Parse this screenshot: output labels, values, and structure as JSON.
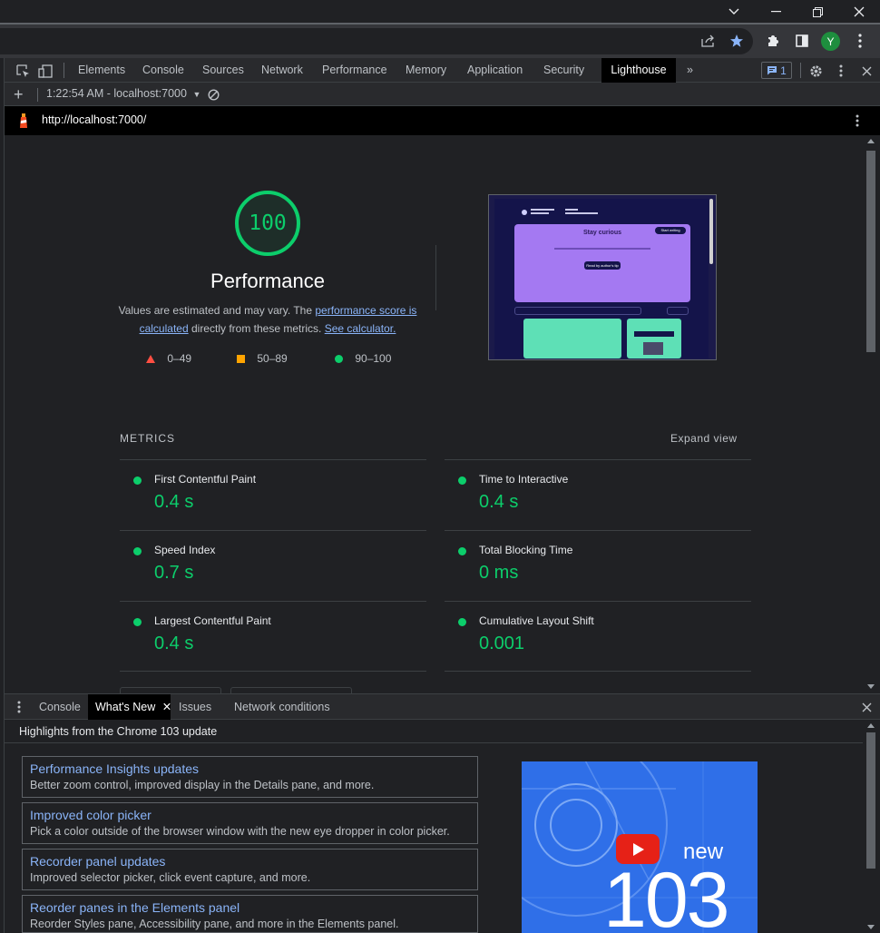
{
  "window": {
    "minimize": "—",
    "restore": "❐",
    "close": "✕",
    "dropdown": "⌄"
  },
  "toolbar": {
    "avatar_letter": "Y"
  },
  "devtools": {
    "tabs": [
      {
        "label": "Elements"
      },
      {
        "label": "Console"
      },
      {
        "label": "Sources"
      },
      {
        "label": "Network"
      },
      {
        "label": "Performance"
      },
      {
        "label": "Memory"
      },
      {
        "label": "Application"
      },
      {
        "label": "Security"
      },
      {
        "label": "Lighthouse"
      }
    ],
    "more_tabs": "»",
    "issues_count": "1",
    "lighthouse_toolbar": {
      "plus": "+",
      "report_select": "1:22:54 AM - localhost:7000",
      "caret": "▼"
    },
    "url": "http://localhost:7000/"
  },
  "report": {
    "score": "100",
    "category_title": "Performance",
    "desc_prefix": "Values are estimated and may vary. The ",
    "desc_link1": "performance score is calculated",
    "desc_middle": " directly from these metrics. ",
    "desc_link2": "See calculator.",
    "legend": [
      {
        "range": "0–49",
        "color": "#ff4e42"
      },
      {
        "range": "50–89",
        "color": "#ffa400"
      },
      {
        "range": "90–100",
        "color": "#0cce6b"
      }
    ],
    "metrics_header": "METRICS",
    "expand_view": "Expand view",
    "metrics": [
      {
        "label": "First Contentful Paint",
        "value": "0.4 s"
      },
      {
        "label": "Time to Interactive",
        "value": "0.4 s"
      },
      {
        "label": "Speed Index",
        "value": "0.7 s"
      },
      {
        "label": "Total Blocking Time",
        "value": "0 ms"
      },
      {
        "label": "Largest Contentful Paint",
        "value": "0.4 s"
      },
      {
        "label": "Cumulative Layout Shift",
        "value": "0.001"
      }
    ],
    "preview": {
      "hero_title": "Stay curious",
      "hero_button": "Start writing",
      "read_button": "Read by author's tip"
    }
  },
  "drawer": {
    "tabs": [
      {
        "label": "Console"
      },
      {
        "label": "What's New"
      },
      {
        "label": "Issues"
      },
      {
        "label": "Network conditions"
      }
    ],
    "close_tab": "✕",
    "header": "Highlights from the Chrome 103 update",
    "cards": [
      {
        "title": "Performance Insights updates",
        "desc": "Better zoom control, improved display in the Details pane, and more."
      },
      {
        "title": "Improved color picker",
        "desc": "Pick a color outside of the browser window with the new eye dropper in color picker."
      },
      {
        "title": "Recorder panel updates",
        "desc": "Improved selector picker, click event capture, and more."
      },
      {
        "title": "Reorder panes in the Elements panel",
        "desc": "Reorder Styles pane, Accessibility pane, and more in the Elements panel."
      }
    ],
    "video": {
      "word": "new",
      "number": "103"
    }
  },
  "colors": {
    "good": "#0cce6b",
    "link": "#8ab4f8",
    "accent": "#1a73e8"
  }
}
